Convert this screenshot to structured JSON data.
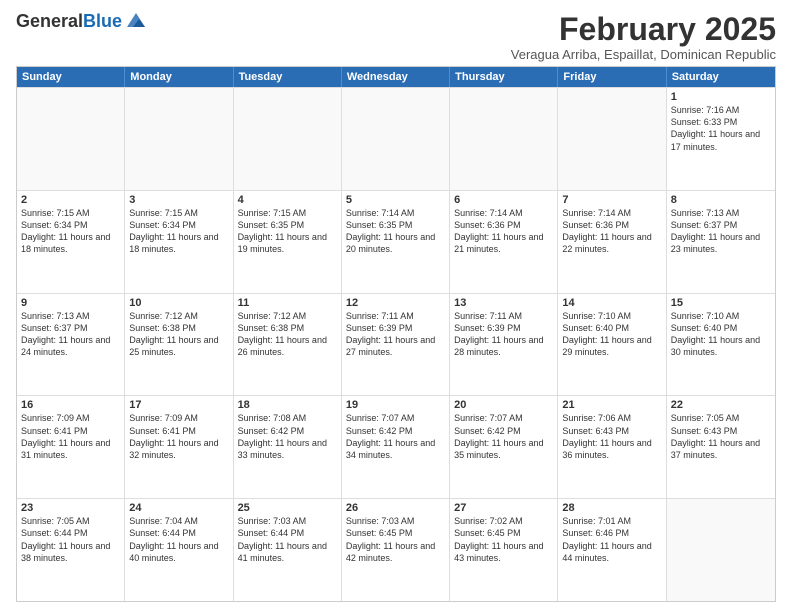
{
  "logo": {
    "general": "General",
    "blue": "Blue"
  },
  "header": {
    "month_title": "February 2025",
    "subtitle": "Veragua Arriba, Espaillat, Dominican Republic"
  },
  "days_of_week": [
    "Sunday",
    "Monday",
    "Tuesday",
    "Wednesday",
    "Thursday",
    "Friday",
    "Saturday"
  ],
  "weeks": [
    [
      {
        "day": "",
        "empty": true
      },
      {
        "day": "",
        "empty": true
      },
      {
        "day": "",
        "empty": true
      },
      {
        "day": "",
        "empty": true
      },
      {
        "day": "",
        "empty": true
      },
      {
        "day": "",
        "empty": true
      },
      {
        "day": "1",
        "sunrise": "7:16 AM",
        "sunset": "6:33 PM",
        "daylight": "11 hours and 17 minutes."
      }
    ],
    [
      {
        "day": "2",
        "sunrise": "7:15 AM",
        "sunset": "6:34 PM",
        "daylight": "11 hours and 18 minutes."
      },
      {
        "day": "3",
        "sunrise": "7:15 AM",
        "sunset": "6:34 PM",
        "daylight": "11 hours and 18 minutes."
      },
      {
        "day": "4",
        "sunrise": "7:15 AM",
        "sunset": "6:35 PM",
        "daylight": "11 hours and 19 minutes."
      },
      {
        "day": "5",
        "sunrise": "7:14 AM",
        "sunset": "6:35 PM",
        "daylight": "11 hours and 20 minutes."
      },
      {
        "day": "6",
        "sunrise": "7:14 AM",
        "sunset": "6:36 PM",
        "daylight": "11 hours and 21 minutes."
      },
      {
        "day": "7",
        "sunrise": "7:14 AM",
        "sunset": "6:36 PM",
        "daylight": "11 hours and 22 minutes."
      },
      {
        "day": "8",
        "sunrise": "7:13 AM",
        "sunset": "6:37 PM",
        "daylight": "11 hours and 23 minutes."
      }
    ],
    [
      {
        "day": "9",
        "sunrise": "7:13 AM",
        "sunset": "6:37 PM",
        "daylight": "11 hours and 24 minutes."
      },
      {
        "day": "10",
        "sunrise": "7:12 AM",
        "sunset": "6:38 PM",
        "daylight": "11 hours and 25 minutes."
      },
      {
        "day": "11",
        "sunrise": "7:12 AM",
        "sunset": "6:38 PM",
        "daylight": "11 hours and 26 minutes."
      },
      {
        "day": "12",
        "sunrise": "7:11 AM",
        "sunset": "6:39 PM",
        "daylight": "11 hours and 27 minutes."
      },
      {
        "day": "13",
        "sunrise": "7:11 AM",
        "sunset": "6:39 PM",
        "daylight": "11 hours and 28 minutes."
      },
      {
        "day": "14",
        "sunrise": "7:10 AM",
        "sunset": "6:40 PM",
        "daylight": "11 hours and 29 minutes."
      },
      {
        "day": "15",
        "sunrise": "7:10 AM",
        "sunset": "6:40 PM",
        "daylight": "11 hours and 30 minutes."
      }
    ],
    [
      {
        "day": "16",
        "sunrise": "7:09 AM",
        "sunset": "6:41 PM",
        "daylight": "11 hours and 31 minutes."
      },
      {
        "day": "17",
        "sunrise": "7:09 AM",
        "sunset": "6:41 PM",
        "daylight": "11 hours and 32 minutes."
      },
      {
        "day": "18",
        "sunrise": "7:08 AM",
        "sunset": "6:42 PM",
        "daylight": "11 hours and 33 minutes."
      },
      {
        "day": "19",
        "sunrise": "7:07 AM",
        "sunset": "6:42 PM",
        "daylight": "11 hours and 34 minutes."
      },
      {
        "day": "20",
        "sunrise": "7:07 AM",
        "sunset": "6:42 PM",
        "daylight": "11 hours and 35 minutes."
      },
      {
        "day": "21",
        "sunrise": "7:06 AM",
        "sunset": "6:43 PM",
        "daylight": "11 hours and 36 minutes."
      },
      {
        "day": "22",
        "sunrise": "7:05 AM",
        "sunset": "6:43 PM",
        "daylight": "11 hours and 37 minutes."
      }
    ],
    [
      {
        "day": "23",
        "sunrise": "7:05 AM",
        "sunset": "6:44 PM",
        "daylight": "11 hours and 38 minutes."
      },
      {
        "day": "24",
        "sunrise": "7:04 AM",
        "sunset": "6:44 PM",
        "daylight": "11 hours and 40 minutes."
      },
      {
        "day": "25",
        "sunrise": "7:03 AM",
        "sunset": "6:44 PM",
        "daylight": "11 hours and 41 minutes."
      },
      {
        "day": "26",
        "sunrise": "7:03 AM",
        "sunset": "6:45 PM",
        "daylight": "11 hours and 42 minutes."
      },
      {
        "day": "27",
        "sunrise": "7:02 AM",
        "sunset": "6:45 PM",
        "daylight": "11 hours and 43 minutes."
      },
      {
        "day": "28",
        "sunrise": "7:01 AM",
        "sunset": "6:46 PM",
        "daylight": "11 hours and 44 minutes."
      },
      {
        "day": "",
        "empty": true
      }
    ]
  ]
}
